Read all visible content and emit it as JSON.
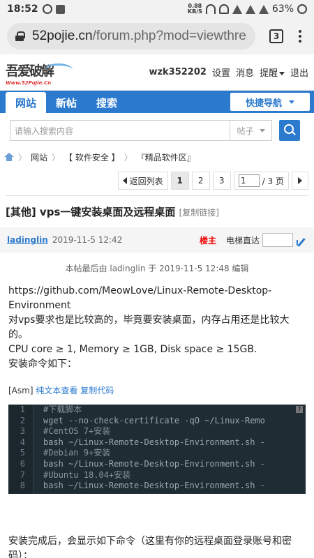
{
  "statusbar": {
    "time": "18:52",
    "speed_value": "0.88",
    "speed_unit": "KB/S",
    "battery": "63%"
  },
  "browser": {
    "url_domain": "52pojie.cn",
    "url_path": "/forum.php?mod=viewthread",
    "tab_count": "3"
  },
  "site": {
    "logo_text": "吾爱破解",
    "logo_sub": "Www.52PoJie.Cn",
    "username": "wzk352202",
    "links": [
      "设置",
      "消息",
      "提醒",
      "退出"
    ]
  },
  "nav": {
    "tabs": [
      "网站",
      "新帖",
      "搜索"
    ],
    "quick_nav": "快捷导航"
  },
  "search": {
    "placeholder": "请输入搜索内容",
    "type": "帖子"
  },
  "breadcrumb": [
    "网站",
    "【 软件安全 】",
    "『精品软件区』"
  ],
  "pager": {
    "back": "返回列表",
    "pages": [
      "1",
      "2",
      "3"
    ],
    "input_value": "1",
    "total": "/ 3 页"
  },
  "thread": {
    "title": "[其他] vps一键安装桌面及远程桌面",
    "copy_link": "[复制链接]"
  },
  "post": {
    "author": "ladinglin",
    "time": "2019-11-5 12:42",
    "floor": "楼主",
    "jump_label": "电梯直达",
    "edited": "本帖最后由 ladinglin 于 2019-11-5 12:48 编辑",
    "lines": [
      "https://github.com/MeowLove/Linux-Remote-Desktop-Environment",
      "对vps要求也是比较高的，毕竟要安装桌面，内存占用还是比较大的。",
      "CPU core ≥ 1, Memory ≥ 1GB, Disk space ≥ 15GB.",
      "安装命令如下："
    ],
    "code_lang": "[Asm]",
    "code_view": "纯文本查看",
    "code_copy": "复制代码",
    "code": [
      {
        "n": "1",
        "t": "#下载脚本"
      },
      {
        "n": "2",
        "t": "wget --no-check-certificate -qO ~/Linux-Remo"
      },
      {
        "n": "3",
        "t": "#CentOS 7+安装"
      },
      {
        "n": "4",
        "t": "bash ~/Linux-Remote-Desktop-Environment.sh -"
      },
      {
        "n": "5",
        "t": "#Debian 9+安装"
      },
      {
        "n": "6",
        "t": "bash ~/Linux-Remote-Desktop-Environment.sh -"
      },
      {
        "n": "7",
        "t": "#Ubuntu 18.04+安装"
      },
      {
        "n": "8",
        "t": "bash ~/Linux-Remote-Desktop-Environment.sh -"
      }
    ],
    "after_text": "安装完成后，会显示如下命令（这里有你的远程桌面登录账号和密码）："
  }
}
